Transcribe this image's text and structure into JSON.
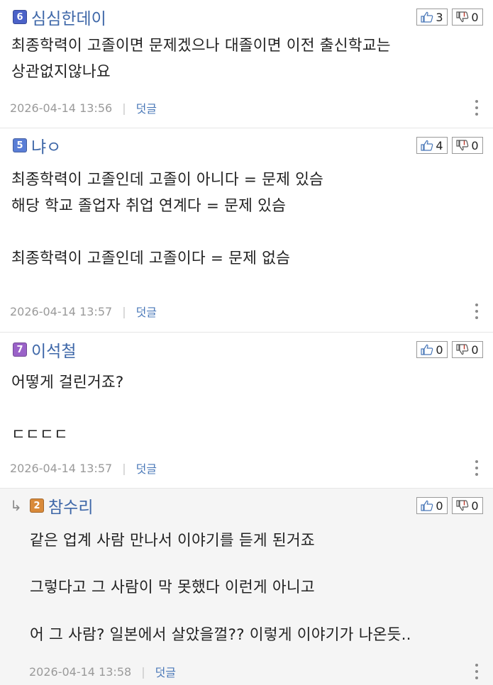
{
  "comments": [
    {
      "level": "6",
      "level_color": "#4b62c8",
      "nick": "심심한데이",
      "up": "3",
      "down": "0",
      "lines": [
        "최종학력이 고졸이면 문제겠으나 대졸이면 이전 출신학교는",
        "상관없지않나요"
      ],
      "date": "2026-04-14 13:56",
      "reply_label": "덧글"
    },
    {
      "level": "5",
      "level_color": "#5a7ed6",
      "nick": "냐ㅇ",
      "up": "4",
      "down": "0",
      "lines": [
        "최종학력이 고졸인데 고졸이 아니다 = 문제 있슴",
        "해당 학교 졸업자 취업 연계다 = 문제 있슴",
        "",
        "최종학력이 고졸인데 고졸이다 = 문제 없슴"
      ],
      "date": "2026-04-14 13:57",
      "reply_label": "덧글"
    },
    {
      "level": "7",
      "level_color": "#9a62c8",
      "nick": "이석철",
      "up": "0",
      "down": "0",
      "lines": [
        "어떻게 걸린거죠?",
        "",
        "ㄷㄷㄷㄷ"
      ],
      "date": "2026-04-14 13:57",
      "reply_label": "덧글"
    },
    {
      "level": "2",
      "level_color": "#d98a3a",
      "nick": "참수리",
      "up": "0",
      "down": "0",
      "reply_arrow": "↳",
      "lines": [
        "같은 업계 사람 만나서 이야기를 듣게 된거죠",
        "",
        "그렇다고 그 사람이 막 못했다 이런게 아니고",
        "",
        "어 그 사람? 일본에서 살았을껄?? 이렇게 이야기가 나온듯.."
      ],
      "date": "2026-04-14 13:58",
      "reply_label": "덧글"
    }
  ],
  "meta_separator": "|"
}
